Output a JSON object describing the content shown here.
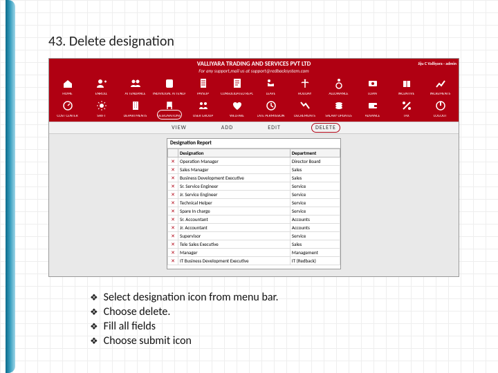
{
  "heading": "43. Delete designation",
  "title_bar": {
    "company": "VALLIYARA TRADING AND SERVICES PVT LTD",
    "subtitle": "For any support,mail us at support@redbacksystem.com",
    "user": "Jiju C Valliyara - admin"
  },
  "ribbon": [
    {
      "label": "HOME",
      "icon": "home"
    },
    {
      "label": "ENROLL",
      "icon": "user-plus"
    },
    {
      "label": "ATTENDANCE",
      "icon": "group"
    },
    {
      "label": "INDIVIDUAL ATTENDANCE",
      "icon": "badge"
    },
    {
      "label": "PAYSLIP",
      "icon": "receipt"
    },
    {
      "label": "CONSOLIDATED REPORT",
      "icon": "doc"
    },
    {
      "label": "LEAVE",
      "icon": "recline"
    },
    {
      "label": "HOLIDAY",
      "icon": "palm"
    },
    {
      "label": "ALLOWANCE",
      "icon": "wheelchair"
    },
    {
      "label": "LOAN",
      "icon": "money"
    },
    {
      "label": "INCENTIVE",
      "icon": "gift"
    },
    {
      "label": "INCREMENTS",
      "icon": "chart-up"
    },
    {
      "label": "COST CENTER",
      "icon": "gauge"
    },
    {
      "label": "SHIFT",
      "icon": "sun"
    },
    {
      "label": "DEPARTMENTS",
      "icon": "building"
    },
    {
      "label": "DESIGNATIONS",
      "icon": "chair",
      "highlight": true
    },
    {
      "label": "USER GROUP",
      "icon": "users"
    },
    {
      "label": "WELFARE",
      "icon": "heart"
    },
    {
      "label": "LATE PERMISSION",
      "icon": "clock"
    },
    {
      "label": "DECREMENTS",
      "icon": "chart-down"
    },
    {
      "label": "SALARY UPDATES",
      "icon": "coins"
    },
    {
      "label": "ADVANCE",
      "icon": "wallet"
    },
    {
      "label": "TAX",
      "icon": "percent"
    },
    {
      "label": "LOGOUT",
      "icon": "power"
    }
  ],
  "actions": [
    {
      "label": "VIEW"
    },
    {
      "label": "ADD"
    },
    {
      "label": "EDIT"
    },
    {
      "label": "DELETE",
      "highlight": true
    }
  ],
  "report": {
    "title": "Designation Report",
    "columns": [
      "Designation",
      "Department"
    ],
    "rows": [
      [
        "Operation Manager",
        "Director Board"
      ],
      [
        "Sales Manager",
        "Sales"
      ],
      [
        "Business Development Executive",
        "Sales"
      ],
      [
        "Sr. Service Engineer",
        "Service"
      ],
      [
        "Jr. Service Engineer",
        "Service"
      ],
      [
        "Technical Helper",
        "Service"
      ],
      [
        "Spare In charge",
        "Service"
      ],
      [
        "Sr. Accountant",
        "Accounts"
      ],
      [
        "Jr. Accountant",
        "Accounts"
      ],
      [
        "Supervisor",
        "Service"
      ],
      [
        "Tele Sales Executive",
        "Sales"
      ],
      [
        "Manager",
        "Management"
      ],
      [
        "IT Business Development Executive",
        "IT (Redback)"
      ]
    ]
  },
  "steps": [
    "Select designation icon from menu bar.",
    "Choose delete.",
    "Fill all fields",
    "Choose submit icon"
  ]
}
